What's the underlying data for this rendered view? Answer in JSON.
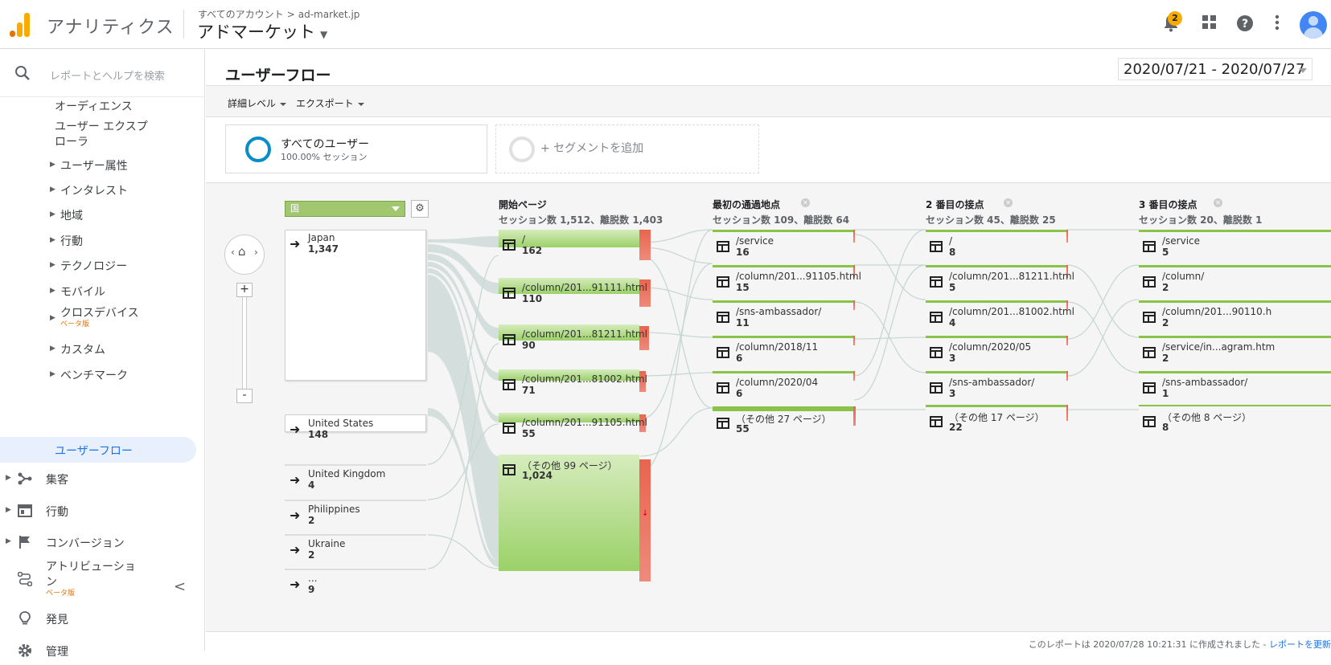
{
  "header": {
    "app_name": "アナリティクス",
    "breadcrumb_account": "すべてのアカウント",
    "breadcrumb_arrow": ">",
    "breadcrumb_property": "ad-market.jp",
    "property_title": "アドマーケット",
    "notification_count": "2",
    "logo_colors": [
      "#f9ab00",
      "#e37400"
    ]
  },
  "sidebar": {
    "search_placeholder": "レポートとヘルプを検索",
    "audience": "オーディエンス",
    "user_explorer_1": "ユーザー エクスプ",
    "user_explorer_2": "ローラ",
    "items": [
      "ユーザー属性",
      "インタレスト",
      "地域",
      "行動",
      "テクノロジー",
      "モバイル"
    ],
    "cross_device": "クロスデバイス",
    "beta": "ベータ版",
    "custom": "カスタム",
    "benchmark": "ベンチマーク",
    "active": "ユーザーフロー",
    "acquisition": "集客",
    "behavior": "行動",
    "conversion": "コンバージョン",
    "attribution_1": "アトリビューショ",
    "attribution_2": "ン",
    "attribution_beta": "ベータ版",
    "discover": "発見",
    "admin": "管理",
    "collapse": "<"
  },
  "report": {
    "title": "ユーザーフロー",
    "date_range": "2020/07/21 - 2020/07/27",
    "detail_level": "詳細レベル",
    "export": "エクスポート",
    "segment_name": "すべてのユーザー",
    "segment_share": "100.00% セッション",
    "add_segment": "+ セグメントを追加",
    "dimension": "国",
    "footer_text": "このレポートは 2020/07/28 10:21:31 に作成されました -",
    "footer_link": "レポートを更新"
  },
  "flow": {
    "zoom_plus": "+",
    "zoom_minus": "-",
    "countries": [
      {
        "name": "Japan",
        "value": "1,347"
      },
      {
        "name": "United States",
        "value": "148"
      },
      {
        "name": "United Kingdom",
        "value": "4"
      },
      {
        "name": "Philippines",
        "value": "2"
      },
      {
        "name": "Ukraine",
        "value": "2"
      },
      {
        "name": "...",
        "value": "9"
      }
    ],
    "columns": [
      {
        "title": "開始ページ",
        "sub": "セッション数 1,512、離脱数 1,403",
        "nodes": [
          {
            "label": "/",
            "value": "162"
          },
          {
            "label": "/column/201...91111.html",
            "value": "110"
          },
          {
            "label": "/column/201...81211.html",
            "value": "90"
          },
          {
            "label": "/column/201...81002.html",
            "value": "71"
          },
          {
            "label": "/column/201...91105.html",
            "value": "55"
          },
          {
            "label": "（その他 99 ページ）",
            "value": "1,024"
          }
        ]
      },
      {
        "title": "最初の通過地点",
        "sub": "セッション数 109、離脱数 64",
        "nodes": [
          {
            "label": "/service",
            "value": "16"
          },
          {
            "label": "/column/201...91105.html",
            "value": "15"
          },
          {
            "label": "/sns-ambassador/",
            "value": "11"
          },
          {
            "label": "/column/2018/11",
            "value": "6"
          },
          {
            "label": "/column/2020/04",
            "value": "6"
          },
          {
            "label": "（その他 27 ページ）",
            "value": "55"
          }
        ]
      },
      {
        "title": "2 番目の接点",
        "sub": "セッション数 45、離脱数 25",
        "nodes": [
          {
            "label": "/",
            "value": "8"
          },
          {
            "label": "/column/201...81211.html",
            "value": "5"
          },
          {
            "label": "/column/201...81002.html",
            "value": "4"
          },
          {
            "label": "/column/2020/05",
            "value": "3"
          },
          {
            "label": "/sns-ambassador/",
            "value": "3"
          },
          {
            "label": "（その他 17 ページ）",
            "value": "22"
          }
        ]
      },
      {
        "title": "3 番目の接点",
        "sub": "セッション数 20、離脱数 1",
        "nodes": [
          {
            "label": "/service",
            "value": "5"
          },
          {
            "label": "/column/",
            "value": "2"
          },
          {
            "label": "/column/201...90110.h",
            "value": "2"
          },
          {
            "label": "/service/in...agram.htm",
            "value": "2"
          },
          {
            "label": "/sns-ambassador/",
            "value": "1"
          },
          {
            "label": "（その他 8 ページ）",
            "value": "8"
          }
        ]
      }
    ]
  }
}
